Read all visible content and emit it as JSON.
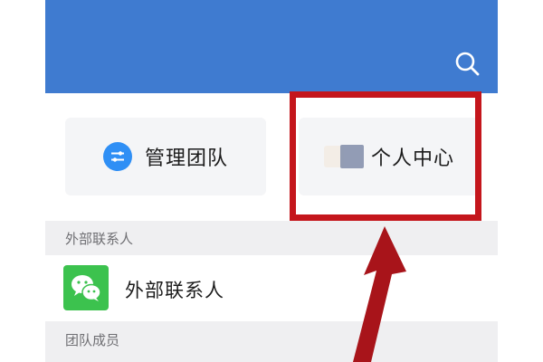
{
  "header": {
    "search_icon": "search-icon",
    "color": "#3f7bd0"
  },
  "tiles": {
    "manage_team": {
      "label": "管理团队",
      "icon": "sliders-icon",
      "icon_color": "#2f8ff5"
    },
    "personal_center": {
      "label": "个人中心",
      "icon": "avatar-icon"
    }
  },
  "sections": {
    "external_header": "外部联系人",
    "external_item": {
      "label": "外部联系人",
      "icon": "wechat-icon",
      "icon_color": "#3cc24e"
    },
    "team_members_header": "团队成员"
  },
  "annotation": {
    "highlight_color": "#c4161c",
    "arrow_color": "#a8141a"
  }
}
